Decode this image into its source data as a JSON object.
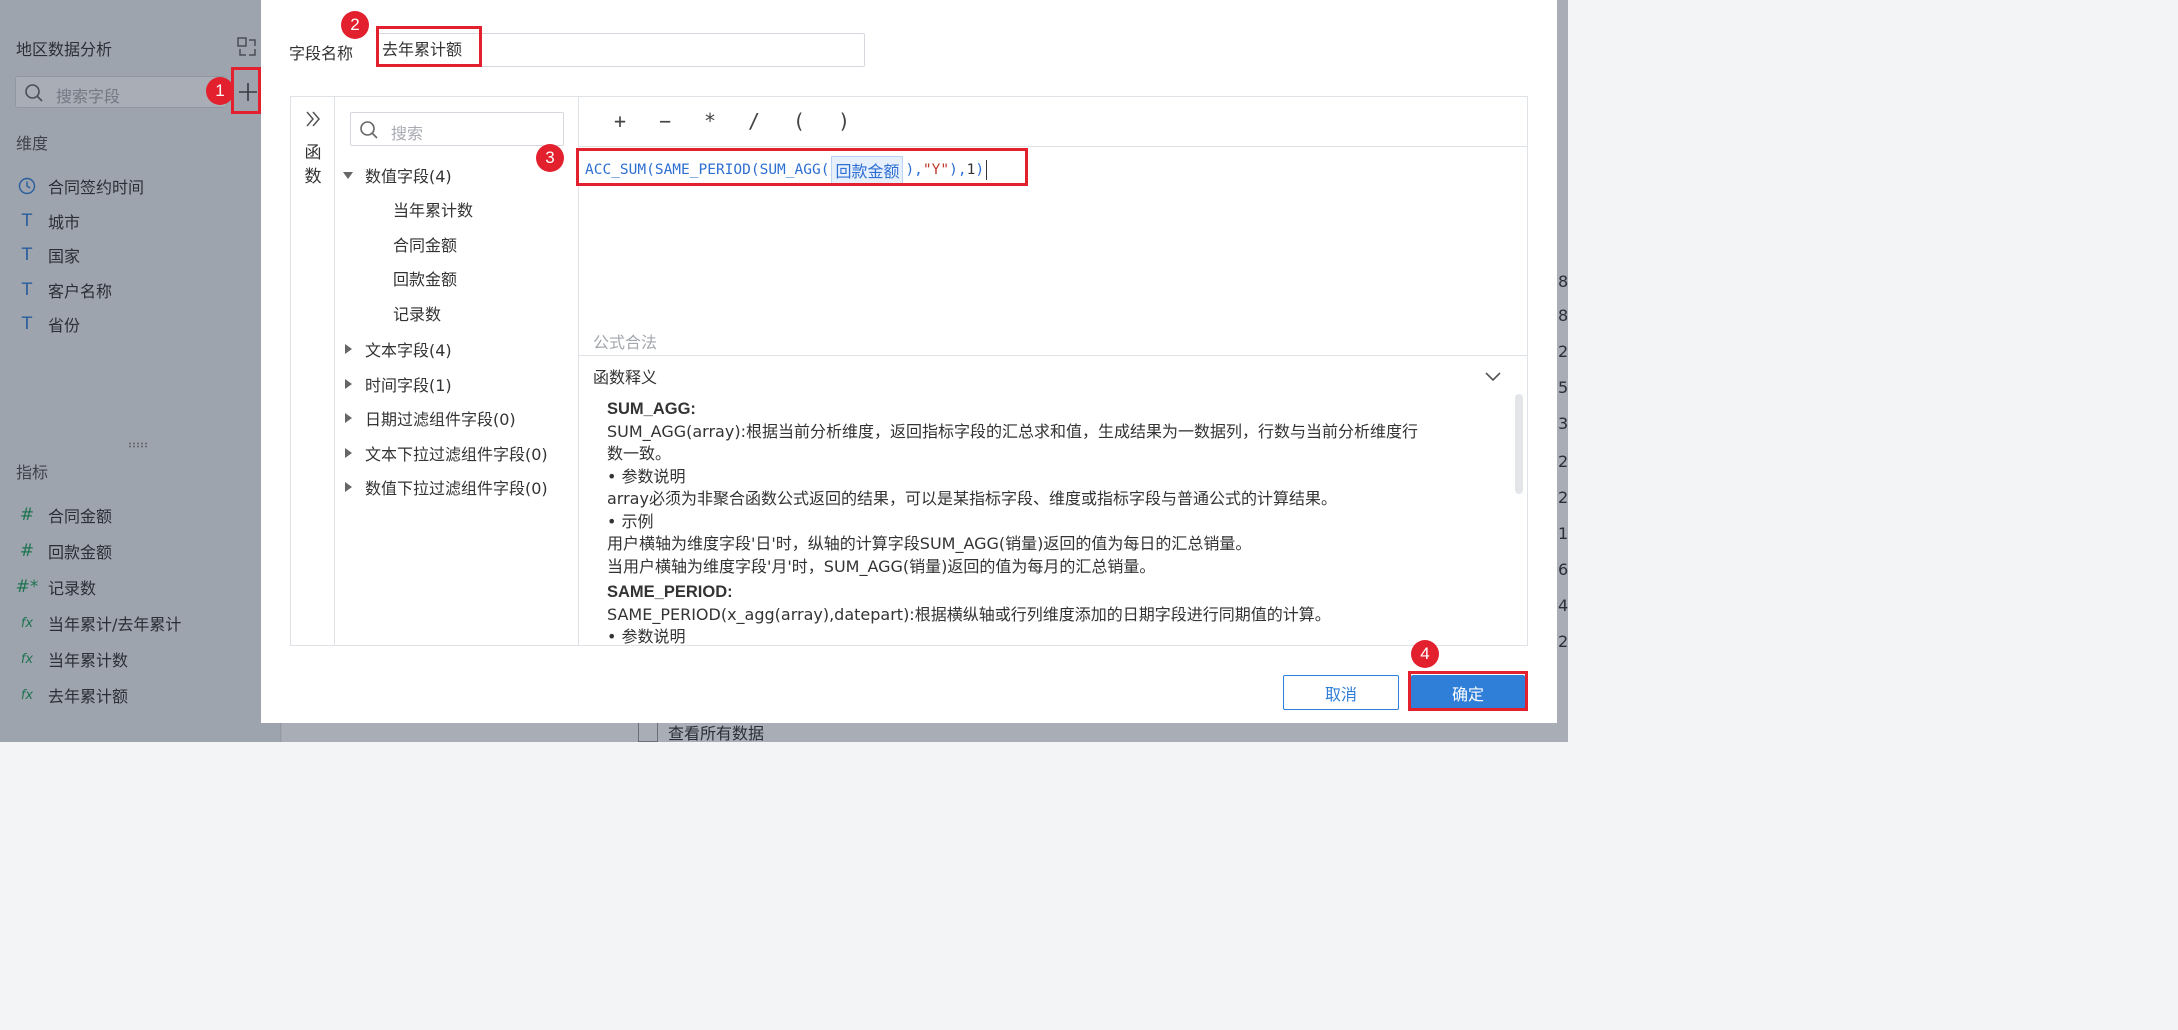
{
  "background": {
    "sidebar": {
      "title": "地区数据分析",
      "search_placeholder": "搜索字段",
      "dimensions_label": "维度",
      "dimensions": [
        {
          "label": "合同签约时间",
          "icon": "clock-icon"
        },
        {
          "label": "城市",
          "icon": "text-type-icon"
        },
        {
          "label": "国家",
          "icon": "text-type-icon"
        },
        {
          "label": "客户名称",
          "icon": "text-type-icon"
        },
        {
          "label": "省份",
          "icon": "text-type-icon"
        }
      ],
      "metrics_label": "指标",
      "metrics": [
        {
          "label": "合同金额",
          "icon": "number-hash-icon"
        },
        {
          "label": "回款金额",
          "icon": "number-hash-icon"
        },
        {
          "label": "记录数",
          "icon": "number-hash-star-icon"
        },
        {
          "label": "当年累计/去年累计",
          "icon": "formula-fx-icon"
        },
        {
          "label": "当年累计数",
          "icon": "formula-fx-icon"
        },
        {
          "label": "去年累计额",
          "icon": "formula-fx-icon"
        }
      ]
    },
    "right_edge_digits": [
      "8",
      "8",
      "2",
      "5",
      "3",
      "2",
      "2",
      "1",
      "6",
      "4",
      "2"
    ],
    "view_all_label": "查看所有数据"
  },
  "dialog": {
    "field_name_label": "字段名称",
    "field_name_value": "去年累计额",
    "function_tab_label": "函数",
    "field_search_placeholder": "搜索",
    "field_groups": [
      {
        "label": "数值字段(4)",
        "expanded": true,
        "children": [
          "当年累计数",
          "合同金额",
          "回款金额",
          "记录数"
        ]
      },
      {
        "label": "文本字段(4)",
        "expanded": false
      },
      {
        "label": "时间字段(1)",
        "expanded": false
      },
      {
        "label": "日期过滤组件字段(0)",
        "expanded": false
      },
      {
        "label": "文本下拉过滤组件字段(0)",
        "expanded": false
      },
      {
        "label": "数值下拉过滤组件字段(0)",
        "expanded": false
      }
    ],
    "operators": [
      "+",
      "−",
      "*",
      "/",
      "(",
      ")"
    ],
    "formula": {
      "part1": "ACC_SUM(SAME_PERIOD(SUM_AGG(",
      "field": "回款金额",
      "part2": "),",
      "string_arg": "\"Y\"",
      "part3": "),",
      "num_arg": "1",
      "part4": ")"
    },
    "validation_text": "公式合法",
    "explain_title": "函数释义",
    "explain_lines": {
      "l1": "SUM_AGG:",
      "l2": "SUM_AGG(array):根据当前分析维度，返回指标字段的汇总求和值，生成结果为一数据列，行数与当前分析维度行",
      "l3": "数一致。",
      "l4": "• 参数说明",
      "l5": "array必须为非聚合函数公式返回的结果，可以是某指标字段、维度或指标字段与普通公式的计算结果。",
      "l6": "• 示例",
      "l7": "用户横轴为维度字段'日'时，纵轴的计算字段SUM_AGG(销量)返回的值为每日的汇总销量。",
      "l8": "当用户横轴为维度字段'月'时，SUM_AGG(销量)返回的值为每月的汇总销量。",
      "l9": "SAME_PERIOD:",
      "l10": "SAME_PERIOD(x_agg(array),datepart):根据横纵轴或行列维度添加的日期字段进行同期值的计算。",
      "l11": "• 参数说明"
    },
    "cancel_label": "取消",
    "ok_label": "确定",
    "step_badges": [
      "1",
      "2",
      "3",
      "4"
    ],
    "colors": {
      "accent": "#2f7ed8",
      "annotation_red": "#e3212e"
    }
  }
}
